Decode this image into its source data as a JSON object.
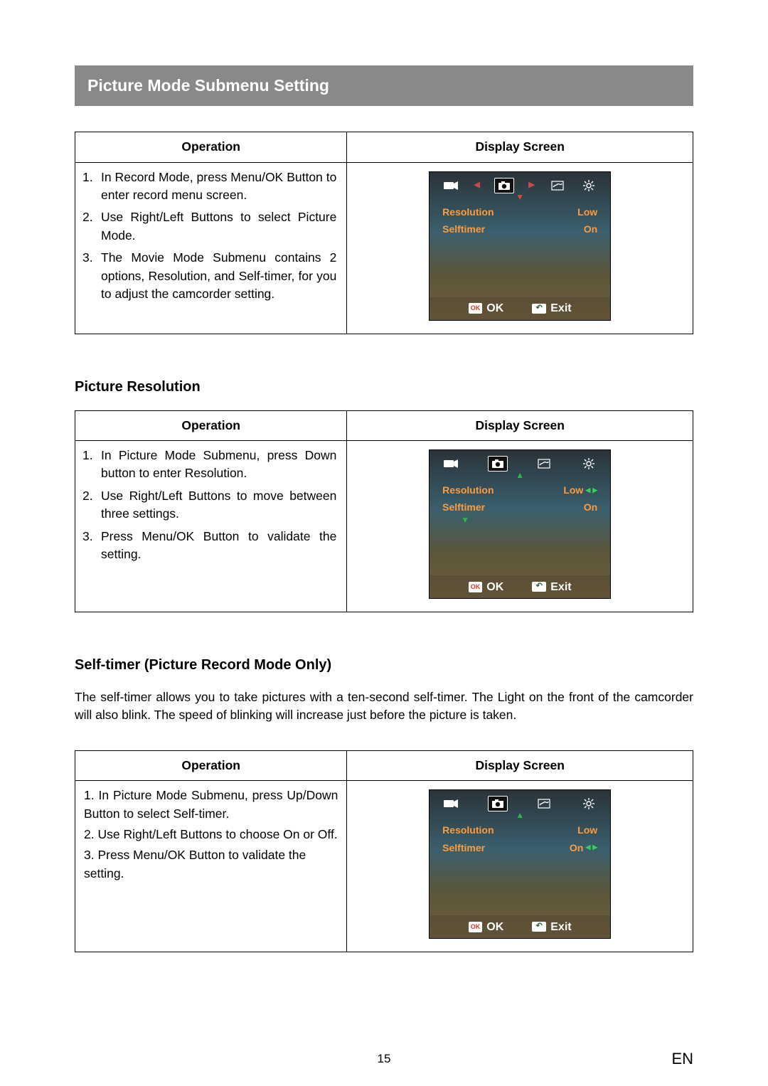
{
  "page": {
    "title": "Picture Mode Submenu Setting",
    "page_number": "15",
    "lang": "EN"
  },
  "table1": {
    "h_op": "Operation",
    "h_ds": "Display Screen",
    "items": [
      "In Record Mode, press Menu/OK Button to enter record menu screen.",
      "Use Right/Left Buttons to select Picture Mode.",
      "The Movie Mode Submenu contains 2 options, Resolution, and Self-timer, for you to adjust the camcorder setting."
    ],
    "screen": {
      "rows": {
        "res_l": "Resolution",
        "res_v": "Low",
        "st_l": "Selftimer",
        "st_v": "On"
      },
      "ok": "OK",
      "exit": "Exit",
      "ok_badge": "OK"
    }
  },
  "section2": {
    "heading": "Picture Resolution"
  },
  "table2": {
    "h_op": "Operation",
    "h_ds": "Display Screen",
    "items": [
      "In Picture Mode Submenu, press Down button to enter Resolution.",
      "Use Right/Left Buttons to move between three settings.",
      "Press Menu/OK Button to validate the setting."
    ],
    "screen": {
      "rows": {
        "res_l": "Resolution",
        "res_v": "Low",
        "st_l": "Selftimer",
        "st_v": "On"
      },
      "ok": "OK",
      "exit": "Exit",
      "ok_badge": "OK"
    }
  },
  "section3": {
    "heading": "Self-timer (Picture Record Mode Only)",
    "para": "The self-timer allows you to take pictures with a ten-second self-timer. The Light on the front of the camcorder will also blink. The speed of blinking will increase just before the picture is taken."
  },
  "table3": {
    "h_op": "Operation",
    "h_ds": "Display Screen",
    "items": [
      "1. In Picture Mode Submenu, press Up/Down Button to select Self-timer.",
      "2. Use Right/Left Buttons to choose On or Off.",
      "3. Press Menu/OK Button to validate the setting."
    ],
    "screen": {
      "rows": {
        "res_l": "Resolution",
        "res_v": "Low",
        "st_l": "Selftimer",
        "st_v": "On"
      },
      "ok": "OK",
      "exit": "Exit",
      "ok_badge": "OK"
    }
  }
}
